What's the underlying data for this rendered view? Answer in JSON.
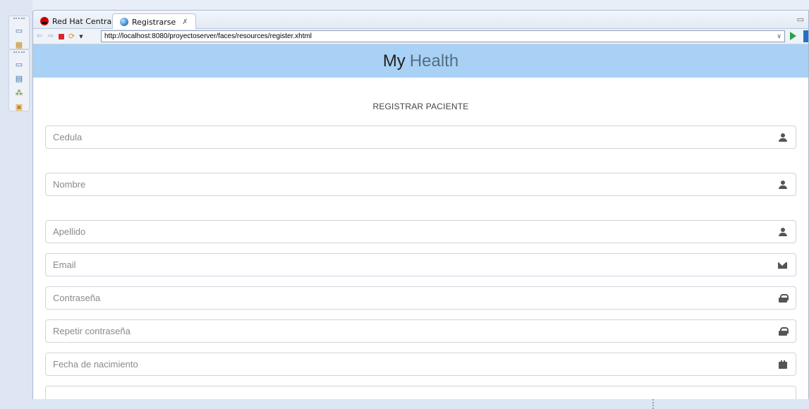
{
  "ide": {
    "tabs": [
      {
        "label": "Red Hat Central"
      },
      {
        "label": "Registrarse",
        "close_glyph": "✗"
      }
    ],
    "browser": {
      "url": "http://localhost:8080/proyectoserver/faces/resources/register.xhtml"
    }
  },
  "app": {
    "brand_strong": "My",
    "brand_light": "Health",
    "form_title": "REGISTRAR PACIENTE",
    "fields": {
      "cedula": {
        "placeholder": "Cedula",
        "icon": "user-icon"
      },
      "nombre": {
        "placeholder": "Nombre",
        "icon": "user-icon"
      },
      "apellido": {
        "placeholder": "Apellido",
        "icon": "user-icon"
      },
      "email": {
        "placeholder": "Email",
        "icon": "envelope-icon"
      },
      "password": {
        "placeholder": "Contraseña",
        "icon": "lock-icon"
      },
      "repeat_password": {
        "placeholder": "Repetir contraseña",
        "icon": "lock-icon"
      },
      "birth_date": {
        "placeholder": "Fecha de nacimiento",
        "icon": "calendar-icon"
      }
    }
  },
  "colors": {
    "header_bg": "#a9d1f5",
    "brand_dark": "#222222",
    "brand_light": "#546e86"
  }
}
